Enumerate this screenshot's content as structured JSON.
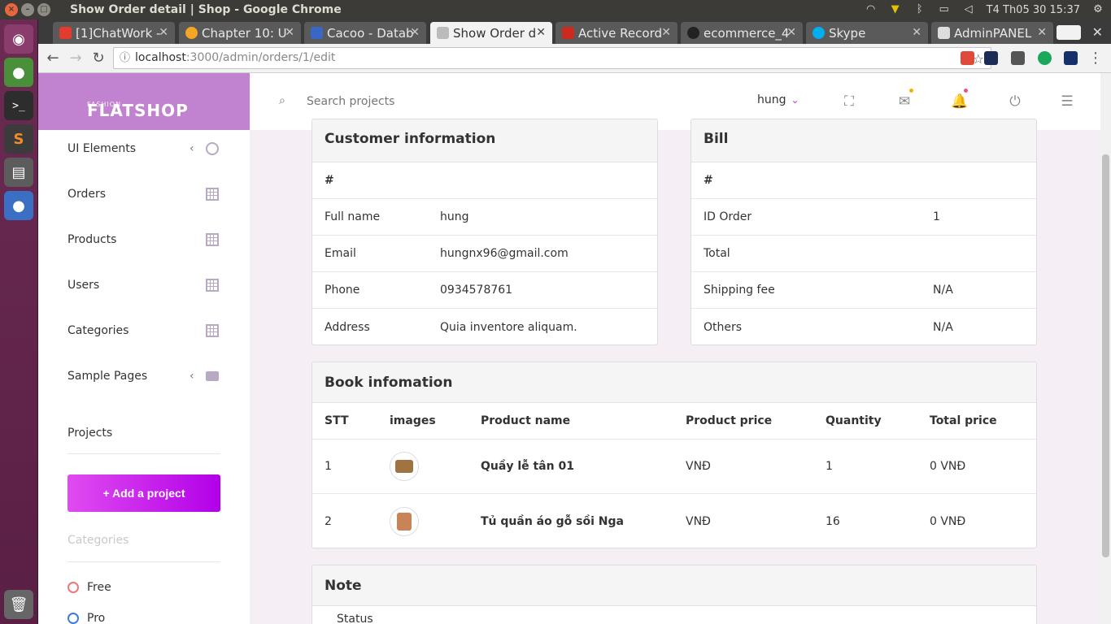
{
  "window": {
    "title": "Show Order detail | Shop - Google Chrome",
    "clock": "T4 Th05 30 15:37"
  },
  "browser": {
    "tabs": [
      {
        "label": "[1]ChatWork -",
        "favicon_color": "#e33b2e"
      },
      {
        "label": "Chapter 10: U",
        "favicon_color": "#f5a623"
      },
      {
        "label": "Cacoo - Datab",
        "favicon_color": "#3b67c4"
      },
      {
        "label": "Show Order d",
        "favicon_color": "#9a9a9a",
        "active": true
      },
      {
        "label": "Active Record",
        "favicon_color": "#cc2a1f"
      },
      {
        "label": "ecommerce_4",
        "favicon_color": "#222222"
      },
      {
        "label": "Skype",
        "favicon_color": "#00aff0"
      },
      {
        "label": "AdminPANEL",
        "favicon_color": "#dddddd"
      }
    ],
    "url_host": "localhost",
    "url_rest": ":3000/admin/orders/1/edit"
  },
  "brand": {
    "line1": "FASHION",
    "line2": "FLATSHOP"
  },
  "sidebar": {
    "items": [
      {
        "label": "UI Elements",
        "icon": "target-icon"
      },
      {
        "label": "Orders",
        "icon": "grid-icon"
      },
      {
        "label": "Products",
        "icon": "grid-icon"
      },
      {
        "label": "Users",
        "icon": "grid-icon"
      },
      {
        "label": "Categories",
        "icon": "grid-icon"
      },
      {
        "label": "Sample Pages",
        "icon": "briefcase-icon"
      }
    ],
    "projects_label": "Projects",
    "add_project_label": "+ Add a project",
    "categories_label": "Categories",
    "category_options": [
      {
        "label": "Free",
        "color": "#f17777"
      },
      {
        "label": "Pro",
        "color": "#3e7bde"
      }
    ]
  },
  "header": {
    "search_placeholder": "Search projects",
    "username": "hung"
  },
  "customer": {
    "title": "Customer information",
    "hash": "#",
    "rows": [
      {
        "label": "Full name",
        "value": "hung"
      },
      {
        "label": "Email",
        "value": "hungnx96@gmail.com"
      },
      {
        "label": "Phone",
        "value": "0934578761"
      },
      {
        "label": "Address",
        "value": "Quia inventore aliquam."
      }
    ]
  },
  "bill": {
    "title": "Bill",
    "hash": "#",
    "rows": [
      {
        "label": "ID Order",
        "value": "1"
      },
      {
        "label": "Total",
        "value": ""
      },
      {
        "label": "Shipping fee",
        "value": "N/A"
      },
      {
        "label": "Others",
        "value": "N/A"
      }
    ]
  },
  "books": {
    "title": "Book infomation",
    "columns": [
      "STT",
      "images",
      "Product name",
      "Product price",
      "Quantity",
      "Total price"
    ],
    "rows": [
      {
        "stt": "1",
        "name": "Quầy lễ tân 01",
        "price": "VNĐ",
        "qty": "1",
        "total": "0 VNĐ",
        "thumb_color": "#a07442"
      },
      {
        "stt": "2",
        "name": "Tủ quần áo gỗ sồi Nga",
        "price": "VNĐ",
        "qty": "16",
        "total": "0 VNĐ",
        "thumb_color": "#c88456"
      }
    ]
  },
  "note": {
    "title": "Note",
    "status_label": "Status"
  }
}
